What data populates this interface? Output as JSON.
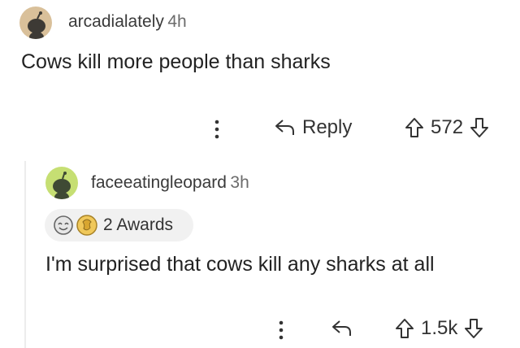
{
  "comment1": {
    "username": "arcadialately",
    "time": "4h",
    "body": "Cows kill more people than sharks",
    "actions": {
      "more_icon": "vertical-ellipsis",
      "reply_icon": "reply-arrow-icon",
      "reply_label": "Reply",
      "score": "572"
    }
  },
  "comment2": {
    "username": "faceeatingleopard",
    "time": "3h",
    "awards_label": "2 Awards",
    "body": "I'm surprised that cows kill any sharks at all",
    "actions": {
      "more_icon": "vertical-ellipsis",
      "reply_icon": "reply-arrow-icon",
      "score": "1.5k"
    }
  },
  "colors": {
    "avatar1_bg": "#d9c09a",
    "avatar2_bg": "#c6df73",
    "text": "#1c1c1c",
    "muted": "#6b6b6b",
    "pill_bg": "#f1f1f1"
  }
}
